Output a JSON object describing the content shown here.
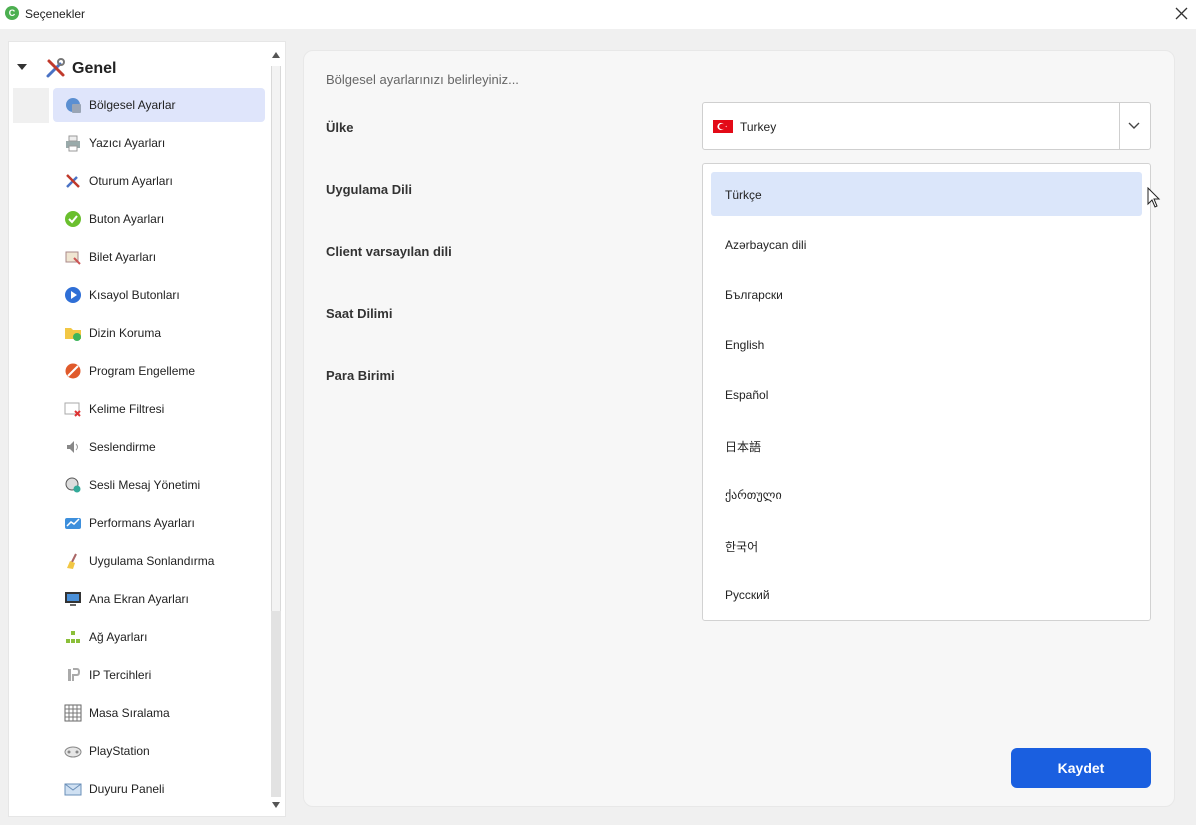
{
  "window": {
    "title": "Seçenekler",
    "app_icon_letter": "C"
  },
  "sidebar": {
    "root": {
      "label": "Genel",
      "expanded": true
    },
    "items": [
      {
        "label": "Bölgesel Ayarlar",
        "icon": "globe-settings-icon",
        "active": true
      },
      {
        "label": "Yazıcı Ayarları",
        "icon": "printer-icon"
      },
      {
        "label": "Oturum Ayarları",
        "icon": "tools-icon"
      },
      {
        "label": "Buton Ayarları",
        "icon": "checkmark-icon"
      },
      {
        "label": "Bilet Ayarları",
        "icon": "ticket-icon"
      },
      {
        "label": "Kısayol Butonları",
        "icon": "play-icon"
      },
      {
        "label": "Dizin Koruma",
        "icon": "folder-shield-icon"
      },
      {
        "label": "Program Engelleme",
        "icon": "block-icon"
      },
      {
        "label": "Kelime Filtresi",
        "icon": "word-filter-icon"
      },
      {
        "label": "Seslendirme",
        "icon": "speaker-icon"
      },
      {
        "label": "Sesli Mesaj Yönetimi",
        "icon": "headset-icon"
      },
      {
        "label": "Performans Ayarları",
        "icon": "performance-icon"
      },
      {
        "label": "Uygulama Sonlandırma",
        "icon": "broom-icon"
      },
      {
        "label": "Ana Ekran Ayarları",
        "icon": "monitor-icon"
      },
      {
        "label": "Ağ Ayarları",
        "icon": "network-icon"
      },
      {
        "label": "IP Tercihleri",
        "icon": "ip-icon"
      },
      {
        "label": "Masa Sıralama",
        "icon": "grid-icon"
      },
      {
        "label": "PlayStation",
        "icon": "gamepad-icon"
      },
      {
        "label": "Duyuru Paneli",
        "icon": "envelope-icon"
      }
    ]
  },
  "main": {
    "hint": "Bölgesel ayarlarınızı belirleyiniz...",
    "fields": {
      "country": "Ülke",
      "app_language": "Uygulama Dili",
      "client_language": "Client varsayılan dili",
      "timezone": "Saat Dilimi",
      "currency": "Para Birimi"
    },
    "country_value": "Turkey",
    "language_options": [
      {
        "label": "Türkçe",
        "selected": true
      },
      {
        "label": "Azərbaycan dili"
      },
      {
        "label": "Български"
      },
      {
        "label": "English"
      },
      {
        "label": "Español"
      },
      {
        "label": "日本語"
      },
      {
        "label": "ქართული"
      },
      {
        "label": "한국어"
      },
      {
        "label": "Русский"
      }
    ],
    "save_label": "Kaydet"
  },
  "colors": {
    "accent": "#1a5fe0",
    "active_item_bg": "#dfe5fb",
    "selected_option_bg": "#dbe6fa",
    "flag_red": "#e30a17"
  }
}
